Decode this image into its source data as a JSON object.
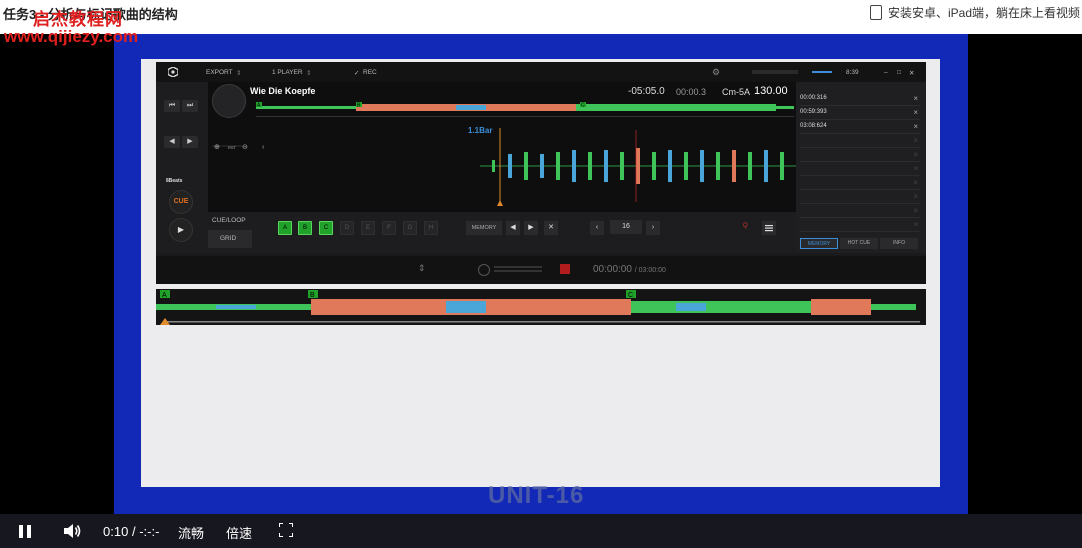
{
  "page": {
    "title": "任务3 - 分析与标记歌曲的结构",
    "watermark_name": "启杰教程网",
    "watermark_url": "www.qijiezy.com",
    "app_promo": "安装安卓、iPad端，躺在床上看视频"
  },
  "slide": {
    "unit_label": "UNIT-16"
  },
  "dj_app": {
    "topbar": {
      "export_label": "EXPORT",
      "player_mode": "1 PLAYER",
      "rec_label": "REC",
      "rec_check": "✓",
      "clock": "8:39",
      "window_controls": [
        "–",
        "□",
        "✕"
      ]
    },
    "deck": {
      "track_title": "Wie Die Koepfe",
      "time_remaining": "-05:05.0",
      "time_elapsed": "00:00.3",
      "key": "Cm-5A",
      "bpm": "130.00",
      "beats_label": "8Beats",
      "cue_label": "CUE",
      "bar_label": "1.1Bar",
      "zoom_rst": "RST",
      "overview_markers": [
        "A",
        "B",
        "C"
      ]
    },
    "controls": {
      "tab_cueloop": "CUE/LOOP",
      "tab_grid": "GRID",
      "hotcues": [
        {
          "label": "A",
          "active": true
        },
        {
          "label": "B",
          "active": true
        },
        {
          "label": "C",
          "active": true
        },
        {
          "label": "D",
          "active": false
        },
        {
          "label": "E",
          "active": false
        },
        {
          "label": "F",
          "active": false
        },
        {
          "label": "G",
          "active": false
        },
        {
          "label": "H",
          "active": false
        }
      ],
      "memory_label": "MEMORY",
      "loop_size": "16",
      "q_label": "Q"
    },
    "side_panel": {
      "cue_points": [
        "00:00:316",
        "00:59:393",
        "03:08:624"
      ],
      "empty_rows": 7,
      "tabs": [
        "MEMORY",
        "HOT CUE",
        "INFO"
      ],
      "active_tab": "MEMORY"
    },
    "transport": {
      "current_time": "00:00:00",
      "total_time": "/ 03:00:00"
    },
    "big_overview": {
      "markers": [
        "A",
        "B",
        "C"
      ]
    }
  },
  "player_bar": {
    "time": "0:10",
    "separator": "/",
    "duration": "-:-:-",
    "quality": "流畅",
    "speed": "倍速"
  },
  "colors": {
    "slide_blue": "#1229b8",
    "wave_green": "#3fc45a",
    "wave_orange": "#e0785a",
    "wave_blue": "#4aa6d8",
    "hotcue_green": "#1fa12a",
    "cue_orange": "#e07020"
  }
}
